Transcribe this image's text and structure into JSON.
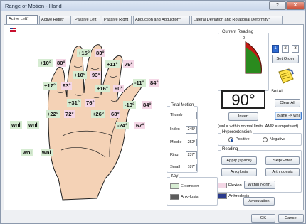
{
  "window": {
    "title": "Range of Motion - Hand",
    "help_label": "?",
    "close_label": "X"
  },
  "tabs": [
    {
      "label": "Active Left*"
    },
    {
      "label": "Active Right*"
    },
    {
      "label": "Passive Left"
    },
    {
      "label": "Passive Right"
    },
    {
      "label": "Abduction and Adduction*"
    },
    {
      "label": "Lateral Deviation and Rotational Deformity*"
    }
  ],
  "measurements": [
    {
      "ext": "+10°",
      "flex": "80°"
    },
    {
      "ext": "+15°",
      "flex": "83°"
    },
    {
      "ext": "+11°",
      "flex": "79°"
    },
    {
      "ext": "+10°",
      "flex": "93°"
    },
    {
      "ext": "+17°",
      "flex": "93°"
    },
    {
      "ext": "+16°",
      "flex": "90°"
    },
    {
      "ext": "-11°",
      "flex": "84°"
    },
    {
      "ext": "+31°",
      "flex": "76°"
    },
    {
      "ext": "+22°",
      "flex": "72°"
    },
    {
      "ext": "+26°",
      "flex": "68°"
    },
    {
      "ext": "-13°",
      "flex": "84°"
    },
    {
      "ext": "-24°",
      "flex": "67°"
    }
  ],
  "wnl_labels": [
    "wnl",
    "wnl",
    "wnl",
    "wnl"
  ],
  "total_motion": {
    "legend": "Total Motion",
    "rows": [
      {
        "label": "Thumb",
        "value": ""
      },
      {
        "label": "Index",
        "value": "245°"
      },
      {
        "label": "Middle",
        "value": "252°"
      },
      {
        "label": "Ring",
        "value": "237°"
      },
      {
        "label": "Small",
        "value": "187°"
      }
    ]
  },
  "key": {
    "legend": "Key",
    "items": [
      {
        "label": "Extension",
        "color": "#d6ecd2"
      },
      {
        "label": "Flexion",
        "color": "#f4d7e6"
      },
      {
        "label": "Ankylosis",
        "color": "#5c5c5c"
      },
      {
        "label": "Arthrodesis",
        "color": "#2a3a8c"
      }
    ]
  },
  "current_reading": {
    "legend": "Current Reading",
    "gauge_zero": "0",
    "value": "90°",
    "invert_label": "Invert"
  },
  "order": {
    "buttons": [
      "1",
      "2",
      "3"
    ],
    "selected": "1",
    "set_order_label": "Set Order"
  },
  "set_all": {
    "legend": "Set All",
    "clear_all_label": "Clear All",
    "blank_wnl_label": "Blank -> wnl"
  },
  "note_text": "(wnl = within normal limits. AMP = amputated)",
  "hyperextension": {
    "legend": "Hyperextension",
    "positive_label": "Positive",
    "negative_label": "Negative",
    "selected": "positive"
  },
  "reading": {
    "legend": "Reading",
    "apply_label": "Apply (space)",
    "skip_label": "Skip/Enter",
    "ankylosis_label": "Ankylosis",
    "arthrodesis_label": "Arthrodesis",
    "within_norm_label": "Within Norm.",
    "amputation_label": "Amputation"
  },
  "footer": {
    "ok_label": "OK",
    "cancel_label": "Cancel"
  }
}
